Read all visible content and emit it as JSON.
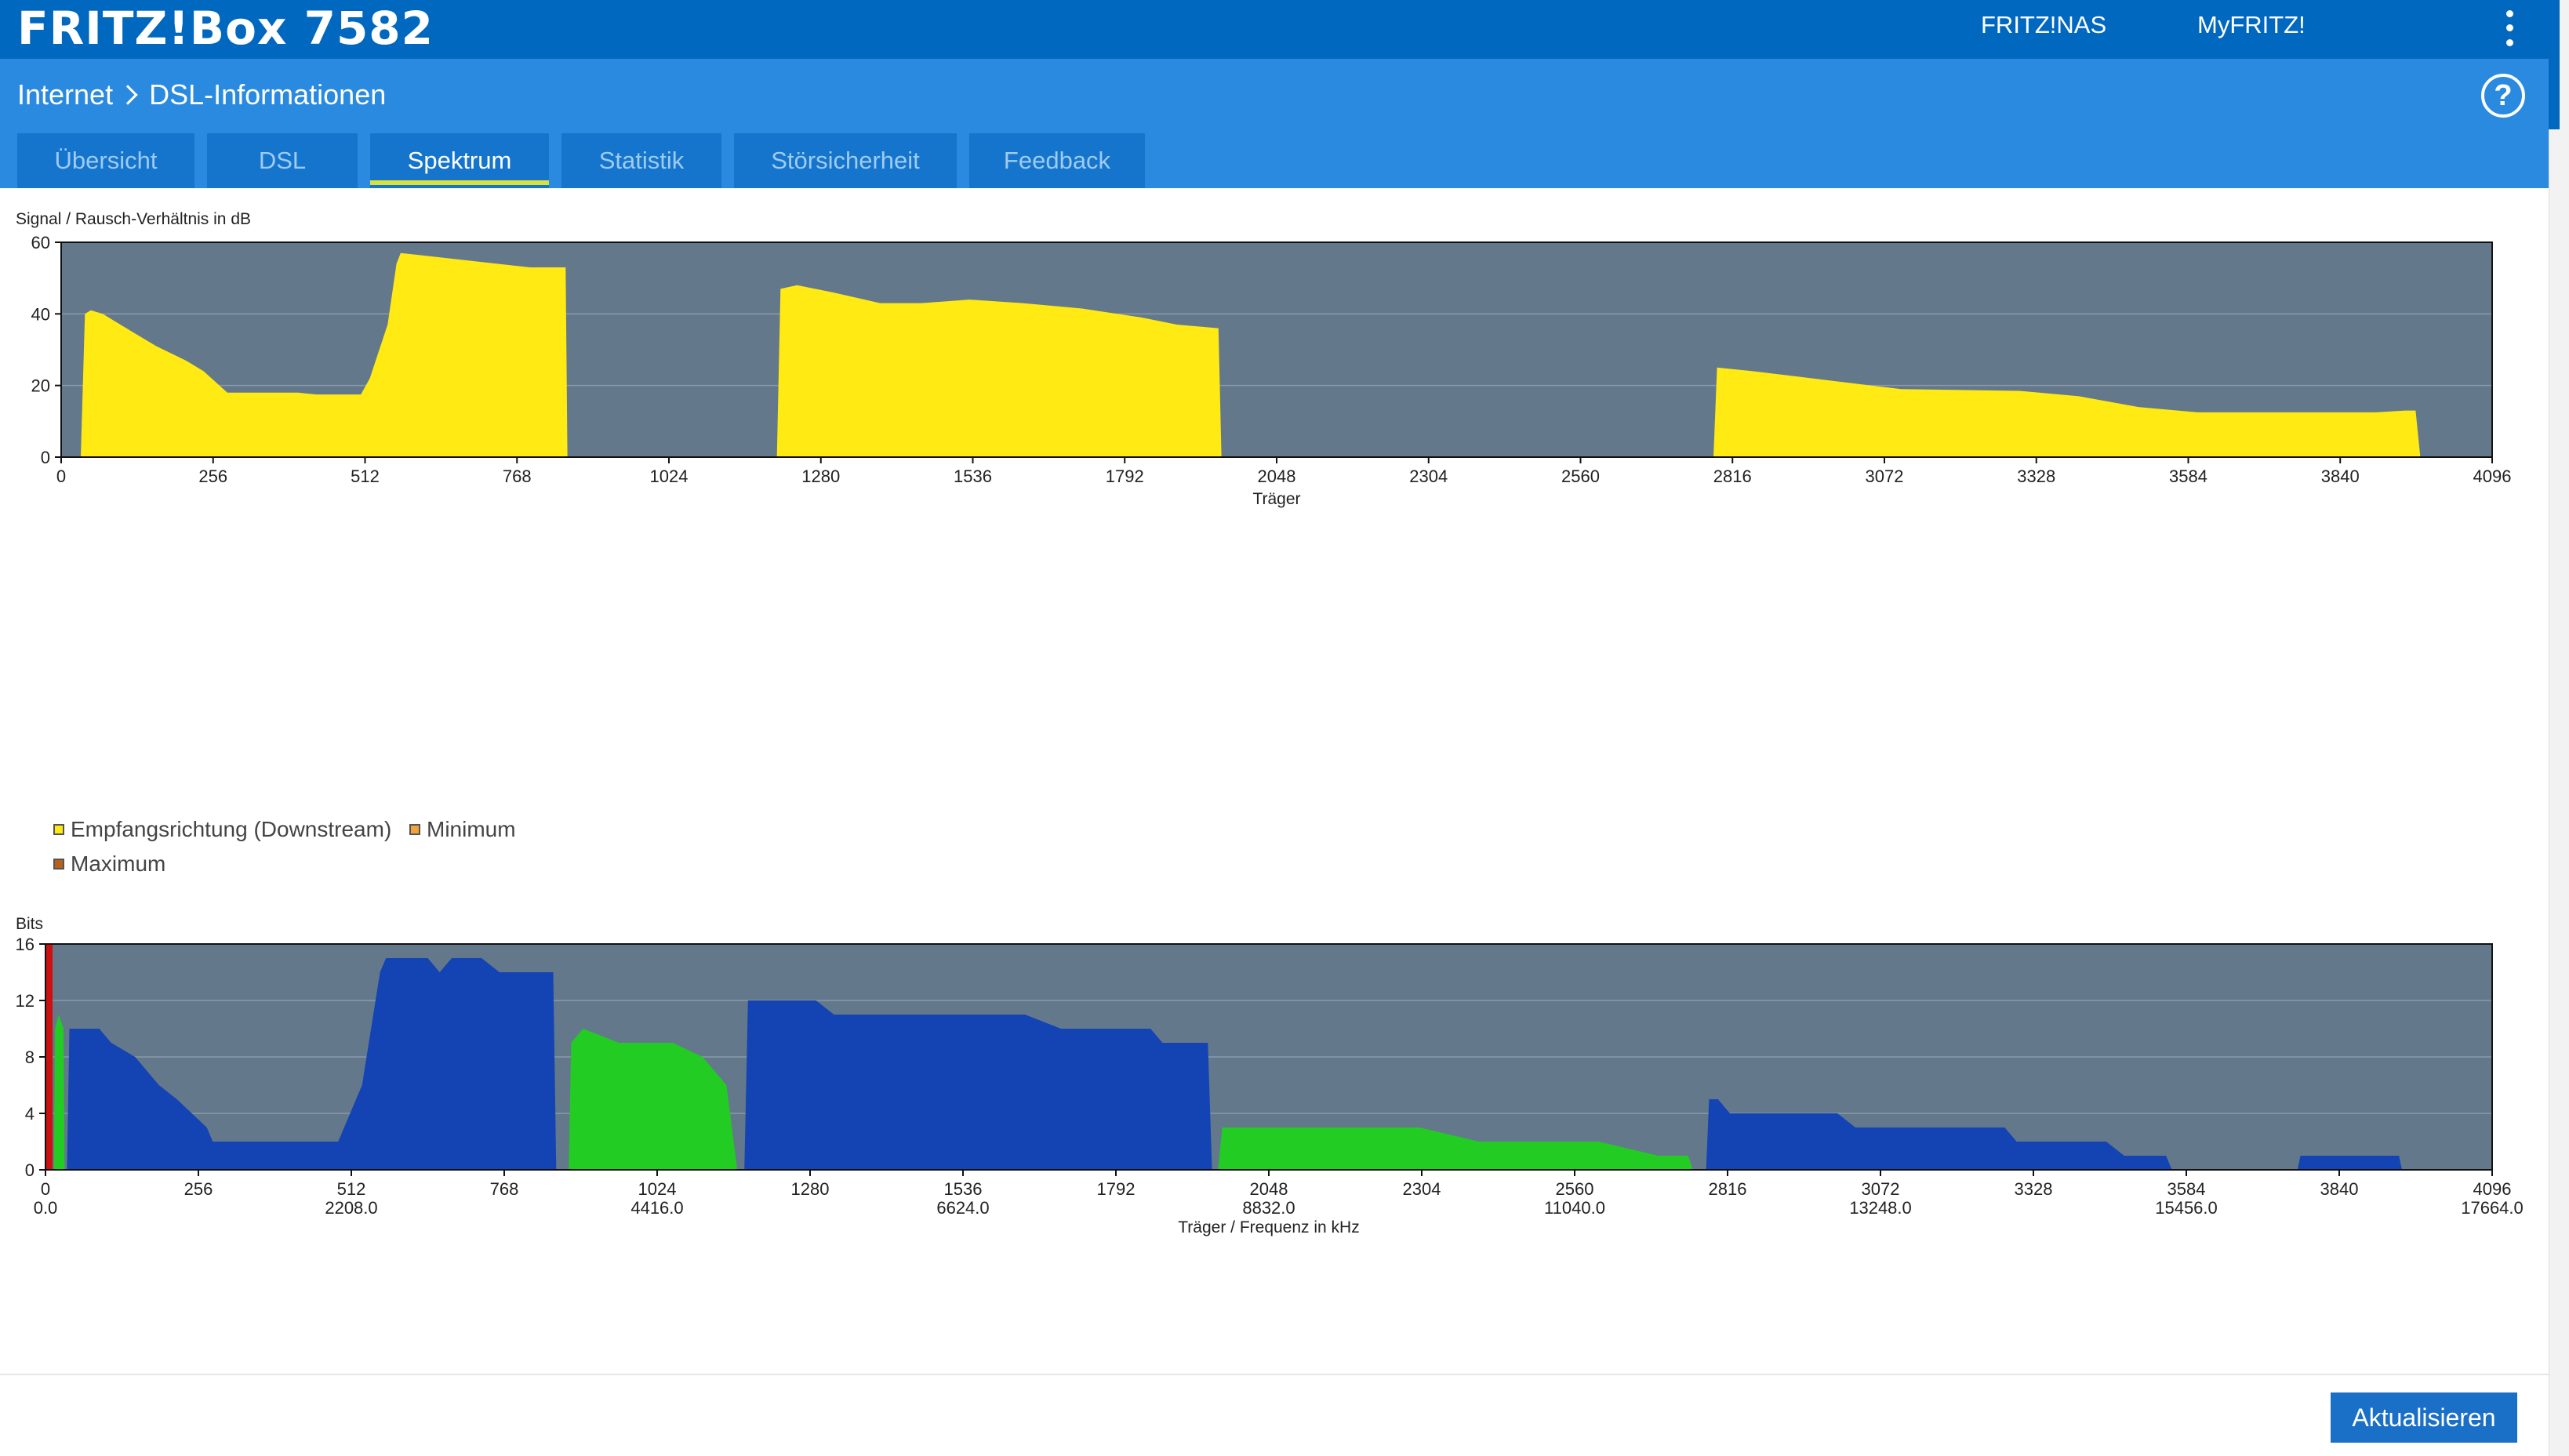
{
  "header": {
    "title": "FRITZ!Box 7582",
    "links": [
      "FRITZ!NAS",
      "MyFRITZ!"
    ]
  },
  "breadcrumb": {
    "section": "Internet",
    "page": "DSL-Informationen"
  },
  "tabs": [
    {
      "label": "Übersicht",
      "active": false
    },
    {
      "label": "DSL",
      "active": false
    },
    {
      "label": "Spektrum",
      "active": true
    },
    {
      "label": "Statistik",
      "active": false
    },
    {
      "label": "Störsicherheit",
      "active": false
    },
    {
      "label": "Feedback",
      "active": false
    }
  ],
  "icons": {
    "help": "help-circle-icon",
    "menu": "more-vertical-icon",
    "breadcrumb_separator": "chevron-right-icon"
  },
  "colors": {
    "header": "#0168c0",
    "subheader": "#2a8ae0",
    "tab": "#1575cc",
    "plot_bg": "#64788c",
    "snr": "#ffea13",
    "downstream_bits": "#1444b4",
    "upstream_bits": "#22cc22",
    "pilot": "#cc1111",
    "button": "#1a6fc6"
  },
  "legend": [
    {
      "label": "Empfangsrichtung (Downstream)",
      "color": "#ffea13"
    },
    {
      "label": "Minimum",
      "color": "#f4a23a"
    },
    {
      "label": "Maximum",
      "color": "#b8601a"
    }
  ],
  "button": {
    "refresh_label": "Aktualisieren"
  },
  "chart_data": [
    {
      "type": "area",
      "title": "Signal / Rausch-Verhältnis in dB",
      "xlabel": "Träger",
      "ylabel": "Signal / Rausch-Verhältnis in dB",
      "xlim": [
        0,
        4096
      ],
      "ylim": [
        0,
        60
      ],
      "x_ticks": [
        "0",
        "256",
        "512",
        "768",
        "1024",
        "1280",
        "1536",
        "1792",
        "2048",
        "2304",
        "2560",
        "2816",
        "3072",
        "3328",
        "3584",
        "3840",
        "4096"
      ],
      "y_ticks": [
        "0",
        "20",
        "40",
        "60"
      ],
      "grid": true,
      "series": [
        {
          "color": "#ffea13",
          "segments": [
            [
              [
                33,
                0
              ],
              [
                40,
                40
              ],
              [
                50,
                41
              ],
              [
                70,
                40
              ],
              [
                90,
                38
              ],
              [
                120,
                35
              ],
              [
                160,
                31
              ],
              [
                210,
                27
              ],
              [
                220,
                26
              ],
              [
                240,
                24
              ],
              [
                280,
                18
              ],
              [
                400,
                18
              ],
              [
                430,
                17.5
              ],
              [
                505,
                17.5
              ],
              [
                520,
                22
              ],
              [
                550,
                37
              ],
              [
                565,
                54
              ],
              [
                572,
                57
              ],
              [
                600,
                56.5
              ],
              [
                680,
                55
              ],
              [
                790,
                53
              ],
              [
                850,
                53
              ],
              [
                853,
                0
              ]
            ],
            [
              [
                1206,
                0
              ],
              [
                1212,
                47
              ],
              [
                1240,
                48
              ],
              [
                1300,
                46
              ],
              [
                1380,
                43
              ],
              [
                1450,
                43
              ],
              [
                1530,
                44
              ],
              [
                1620,
                43
              ],
              [
                1720,
                41.5
              ],
              [
                1820,
                39
              ],
              [
                1880,
                37
              ],
              [
                1950,
                36
              ],
              [
                1955,
                0
              ]
            ],
            [
              [
                2784,
                0
              ],
              [
                2790,
                25
              ],
              [
                2850,
                24
              ],
              [
                2950,
                22
              ],
              [
                3050,
                20
              ],
              [
                3100,
                19
              ],
              [
                3300,
                18.5
              ],
              [
                3400,
                17
              ],
              [
                3500,
                14
              ],
              [
                3600,
                12.5
              ],
              [
                3800,
                12.5
              ],
              [
                3900,
                12.5
              ],
              [
                3950,
                13
              ],
              [
                3967,
                13
              ],
              [
                3975,
                0
              ]
            ]
          ]
        }
      ]
    },
    {
      "type": "area",
      "title": "Bits",
      "xlabel": "Träger / Frequenz in kHz",
      "ylabel": "Bits",
      "xlim": [
        0,
        4096
      ],
      "ylim": [
        0,
        16
      ],
      "x_ticks": [
        "0",
        "256",
        "512",
        "768",
        "1024",
        "1280",
        "1536",
        "1792",
        "2048",
        "2304",
        "2560",
        "2816",
        "3072",
        "3328",
        "3584",
        "3840",
        "4096"
      ],
      "x_freq_ticks": [
        {
          "carrier": 0,
          "label": "0.0"
        },
        {
          "carrier": 512,
          "label": "2208.0"
        },
        {
          "carrier": 1024,
          "label": "4416.0"
        },
        {
          "carrier": 1536,
          "label": "6624.0"
        },
        {
          "carrier": 2048,
          "label": "8832.0"
        },
        {
          "carrier": 2560,
          "label": "11040.0"
        },
        {
          "carrier": 3072,
          "label": "13248.0"
        },
        {
          "carrier": 3584,
          "label": "15456.0"
        },
        {
          "carrier": 4096,
          "label": "17664.0"
        }
      ],
      "y_ticks": [
        "0",
        "4",
        "8",
        "12",
        "16"
      ],
      "grid": true,
      "series": [
        {
          "color": "#cc1111",
          "segments": [
            [
              [
                0,
                0
              ],
              [
                0,
                16
              ],
              [
                12,
                16
              ],
              [
                12,
                0
              ]
            ]
          ]
        },
        {
          "color": "#22cc22",
          "segments": [
            [
              [
                14,
                0
              ],
              [
                16,
                10
              ],
              [
                22,
                11
              ],
              [
                30,
                10
              ],
              [
                32,
                0
              ]
            ],
            [
              [
                876,
                0
              ],
              [
                880,
                9
              ],
              [
                900,
                10
              ],
              [
                960,
                9
              ],
              [
                1000,
                9
              ],
              [
                1050,
                9
              ],
              [
                1100,
                8
              ],
              [
                1140,
                6
              ],
              [
                1158,
                0
              ]
            ],
            [
              [
                1963,
                0
              ],
              [
                1970,
                3
              ],
              [
                2000,
                3
              ],
              [
                2100,
                3
              ],
              [
                2300,
                3
              ],
              [
                2400,
                2
              ],
              [
                2600,
                2
              ],
              [
                2700,
                1
              ],
              [
                2750,
                1
              ],
              [
                2758,
                0
              ]
            ]
          ]
        },
        {
          "color": "#1444b4",
          "segments": [
            [
              [
                36,
                0
              ],
              [
                40,
                10
              ],
              [
                90,
                10
              ],
              [
                110,
                9
              ],
              [
                150,
                8
              ],
              [
                190,
                6
              ],
              [
                220,
                5
              ],
              [
                270,
                3
              ],
              [
                280,
                2
              ],
              [
                490,
                2
              ],
              [
                530,
                6
              ],
              [
                560,
                14
              ],
              [
                570,
                15
              ],
              [
                640,
                15
              ],
              [
                660,
                14
              ],
              [
                680,
                15
              ],
              [
                730,
                15
              ],
              [
                760,
                14
              ],
              [
                850,
                14
              ],
              [
                855,
                0
              ]
            ],
            [
              [
                1170,
                0
              ],
              [
                1176,
                12
              ],
              [
                1290,
                12
              ],
              [
                1320,
                11
              ],
              [
                1440,
                11
              ],
              [
                1460,
                11
              ],
              [
                1640,
                11
              ],
              [
                1700,
                10
              ],
              [
                1850,
                10
              ],
              [
                1870,
                9
              ],
              [
                1946,
                9
              ],
              [
                1953,
                0
              ]
            ],
            [
              [
                2780,
                0
              ],
              [
                2785,
                5
              ],
              [
                2800,
                5
              ],
              [
                2820,
                4
              ],
              [
                3000,
                4
              ],
              [
                3030,
                3
              ],
              [
                3100,
                3
              ],
              [
                3280,
                3
              ],
              [
                3300,
                2
              ],
              [
                3450,
                2
              ],
              [
                3480,
                1
              ],
              [
                3550,
                1
              ],
              [
                3560,
                0
              ]
            ],
            [
              [
                3770,
                0
              ],
              [
                3775,
                1
              ],
              [
                3860,
                1
              ],
              [
                3940,
                1
              ],
              [
                3945,
                0
              ]
            ]
          ]
        }
      ]
    }
  ]
}
